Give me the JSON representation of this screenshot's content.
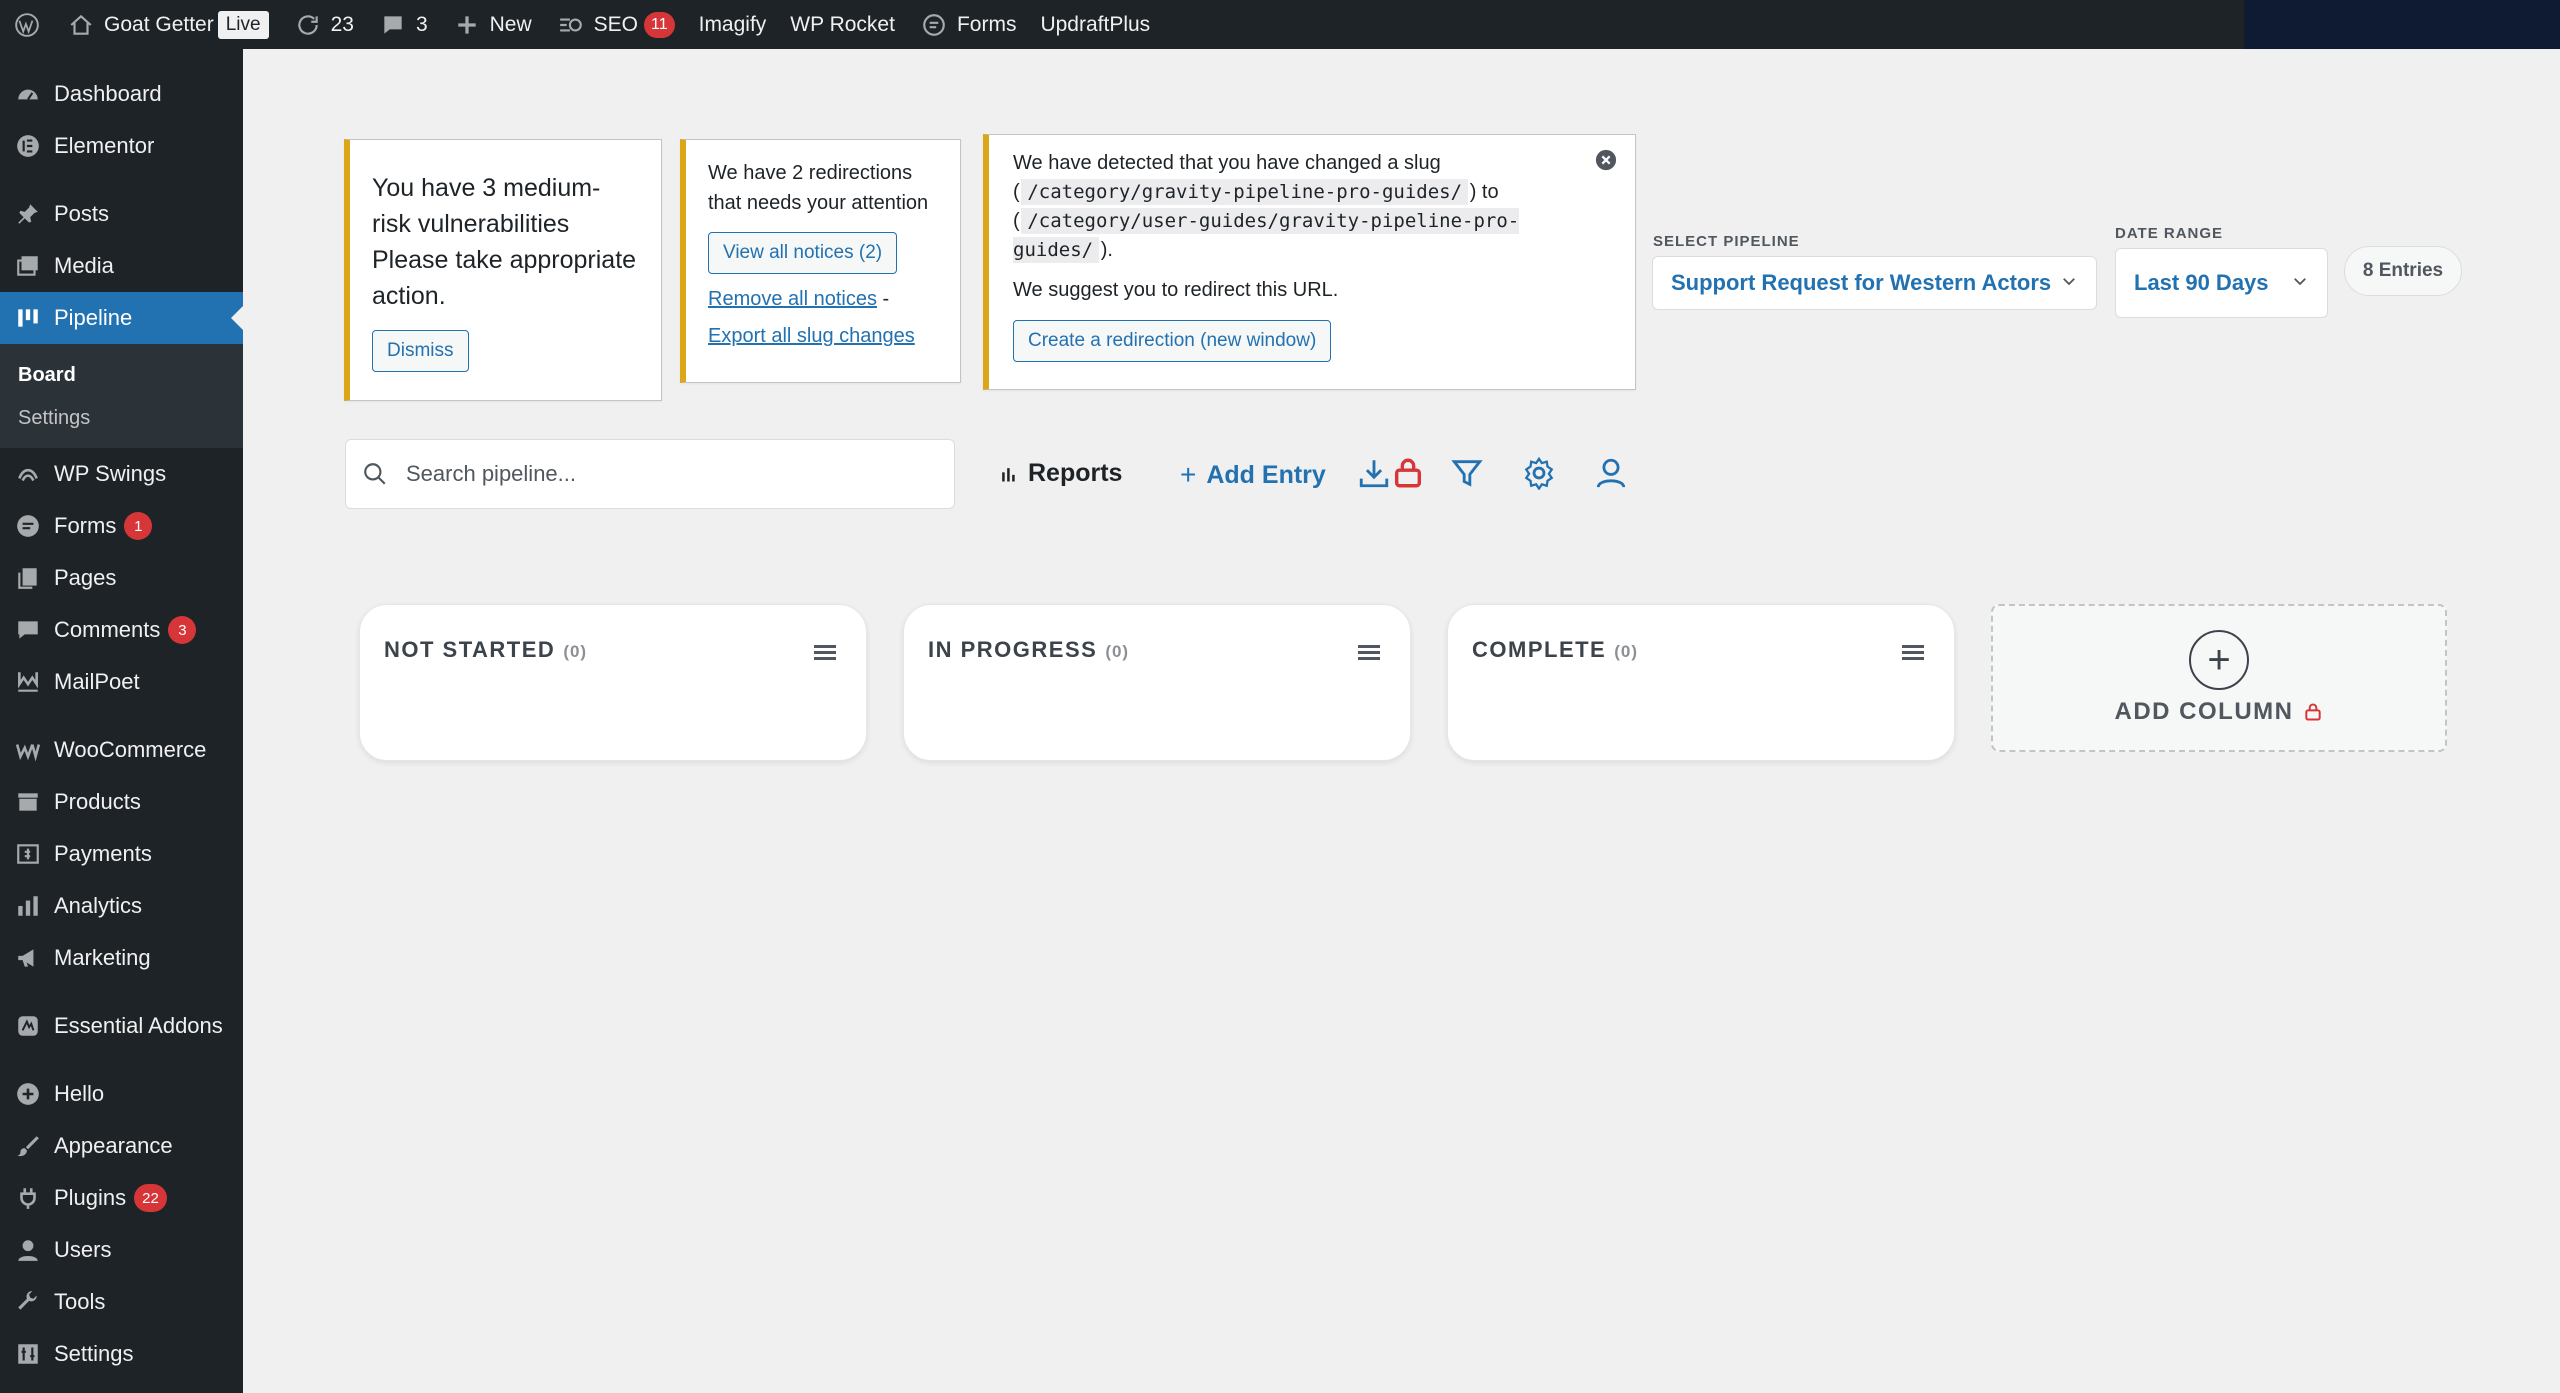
{
  "adminbar": {
    "site_name": "Goat Getter",
    "live_badge": "Live",
    "updates_count": "23",
    "comments_count": "3",
    "new_label": "New",
    "seo_label": "SEO",
    "seo_count": "11",
    "imagify_label": "Imagify",
    "wprocket_label": "WP Rocket",
    "forms_label": "Forms",
    "updraft_label": "UpdraftPlus"
  },
  "sidebar": {
    "dashboard": "Dashboard",
    "elementor": "Elementor",
    "posts": "Posts",
    "media": "Media",
    "pipeline": "Pipeline",
    "board": "Board",
    "settings_sub": "Settings",
    "wpswings": "WP Swings",
    "forms": "Forms",
    "forms_badge": "1",
    "pages": "Pages",
    "comments": "Comments",
    "comments_badge": "3",
    "mailpoet": "MailPoet",
    "woocommerce": "WooCommerce",
    "products": "Products",
    "payments": "Payments",
    "analytics": "Analytics",
    "marketing": "Marketing",
    "essential_addons": "Essential Addons",
    "hello": "Hello",
    "appearance": "Appearance",
    "plugins": "Plugins",
    "plugins_badge": "22",
    "users": "Users",
    "tools": "Tools",
    "settings": "Settings"
  },
  "notices": {
    "vuln_text": "You have 3 medium-risk vulnerabilities Please take appropriate action.",
    "dismiss": "Dismiss",
    "redir_text": "We have 2 redirections that needs your attention",
    "view_all": "View all notices (2)",
    "remove_all": "Remove all notices",
    "remove_sep": "-",
    "export": "Export all slug changes",
    "slug_intro": "We have detected that you have changed a slug",
    "slug_old": "/category/gravity-pipeline-pro-guides/",
    "slug_to": "to",
    "slug_new": "/category/user-guides/gravity-pipeline-pro-guides/",
    "suggest": "We suggest you to redirect this URL.",
    "create_redirect": "Create a redirection (new window)"
  },
  "filters": {
    "pipeline_label": "SELECT PIPELINE",
    "pipeline_value": "Support Request for Western Actors",
    "date_label": "DATE RANGE",
    "date_value": "Last 90 Days",
    "entries": "8 Entries"
  },
  "toolbar": {
    "search_placeholder": "Search pipeline...",
    "reports": "Reports",
    "add_entry": "Add Entry"
  },
  "board": {
    "columns": [
      {
        "title": "NOT STARTED",
        "count": "(0)"
      },
      {
        "title": "IN PROGRESS",
        "count": "(0)"
      },
      {
        "title": "COMPLETE",
        "count": "(0)"
      }
    ],
    "add_column": "ADD COLUMN"
  },
  "colors": {
    "accent": "#2271b1",
    "adminbar": "#1d2327",
    "notice_warning": "#dba617",
    "badge": "#d63638"
  }
}
